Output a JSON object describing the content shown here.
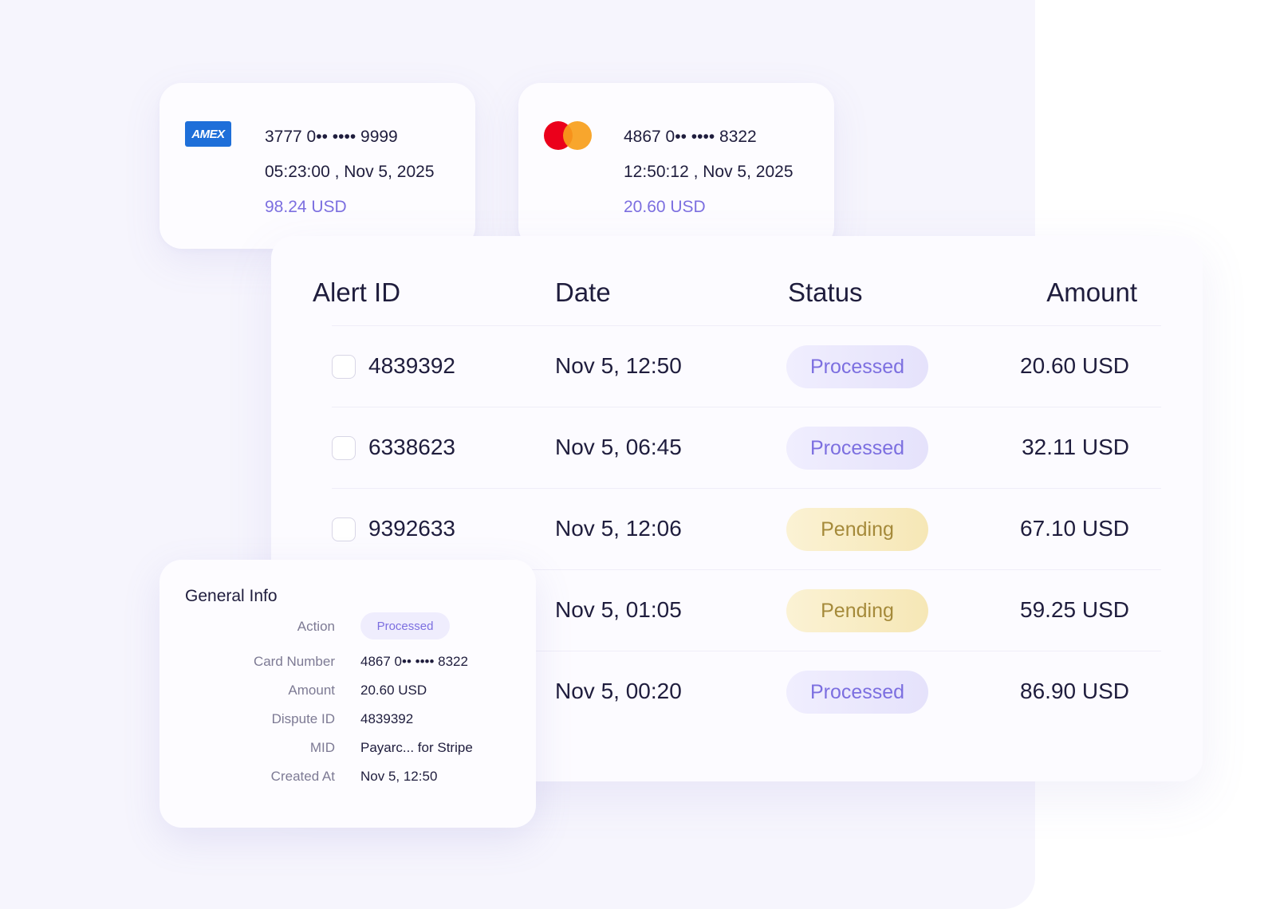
{
  "cards": [
    {
      "brand": "AMEX",
      "number": "3777 0•• •••• 9999",
      "datetime": "05:23:00 , Nov 5, 2025",
      "amount": "98.24 USD"
    },
    {
      "brand": "mastercard",
      "number": "4867 0•• •••• 8322",
      "datetime": "12:50:12 , Nov 5, 2025",
      "amount": "20.60 USD"
    }
  ],
  "table": {
    "headers": {
      "alert_id": "Alert ID",
      "date": "Date",
      "status": "Status",
      "amount": "Amount"
    },
    "rows": [
      {
        "id": "4839392",
        "date": "Nov 5, 12:50",
        "status": "Processed",
        "amount": "20.60 USD"
      },
      {
        "id": "6338623",
        "date": "Nov 5, 06:45",
        "status": "Processed",
        "amount": "32.11 USD"
      },
      {
        "id": "9392633",
        "date": "Nov 5, 12:06",
        "status": "Pending",
        "amount": "67.10 USD"
      },
      {
        "id": "",
        "date": "Nov 5, 01:05",
        "status": "Pending",
        "amount": "59.25 USD"
      },
      {
        "id": "",
        "date": "Nov 5, 00:20",
        "status": "Processed",
        "amount": "86.90 USD"
      }
    ]
  },
  "general_info": {
    "title": "General Info",
    "action_label": "Action",
    "action_value": "Processed",
    "card_number_label": "Card Number",
    "card_number_value": "4867 0•• •••• 8322",
    "amount_label": "Amount",
    "amount_value": "20.60 USD",
    "dispute_id_label": "Dispute ID",
    "dispute_id_value": "4839392",
    "mid_label": "MID",
    "mid_value": "Payarc... for Stripe",
    "created_at_label": "Created At",
    "created_at_value": "Nov 5, 12:50"
  },
  "colors": {
    "accent": "#7c6fe0",
    "processed_bg": "#ebe8fc",
    "pending_bg": "#f8ecc4",
    "pending_text": "#a58a3a"
  }
}
